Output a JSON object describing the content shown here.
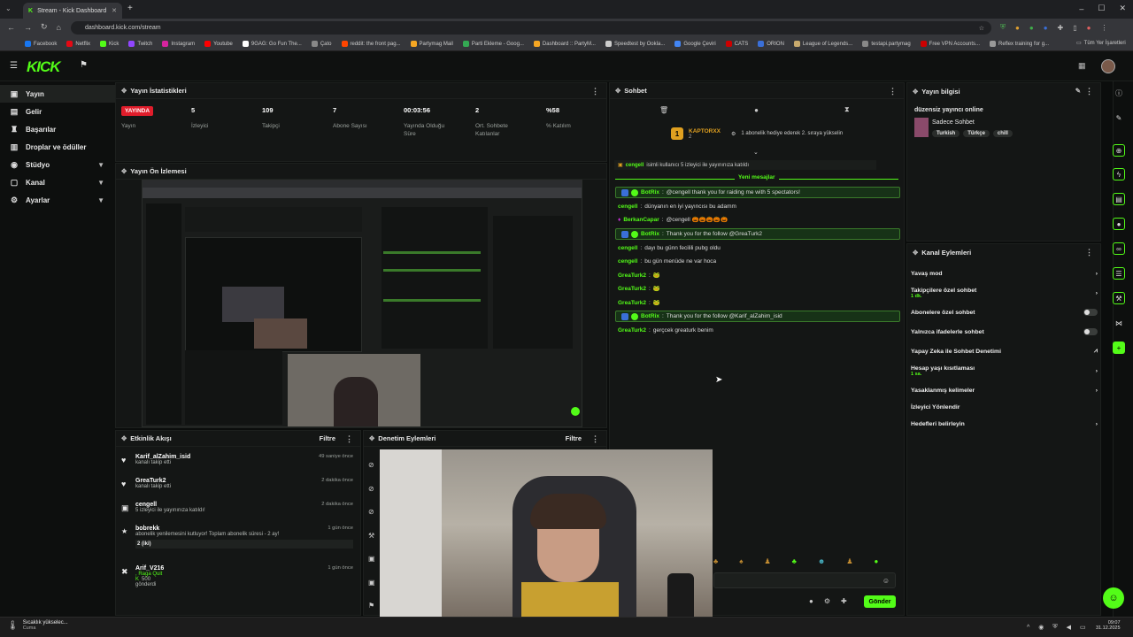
{
  "browser": {
    "tab_title": "Stream - Kick Dashboard",
    "url": "dashboard.kick.com/stream",
    "bookmarks": [
      "Facebook",
      "Netflix",
      "Kick",
      "Twitch",
      "Instagram",
      "Youtube",
      "9GAG: Go Fun The...",
      "Çato",
      "reddit: the front pag...",
      "Partymag Mail",
      "Parti Ekleme - Goog...",
      "Dashboard :: PartyM...",
      "Speedtest by Ookla...",
      "Google Çeviri",
      "CATS",
      "ORION",
      "League of Legends...",
      "testapi.partymag",
      "Free VPN Accounts...",
      "Reflex training for g..."
    ],
    "all_bookmarks": "Tüm Yer İşaretleri"
  },
  "app": {
    "logo": "KICK"
  },
  "sidebar": {
    "items": [
      {
        "label": "Yayın",
        "icon": "broadcast-icon"
      },
      {
        "label": "Gelir",
        "icon": "wallet-icon"
      },
      {
        "label": "Başarılar",
        "icon": "trophy-icon"
      },
      {
        "label": "Droplar ve ödüller",
        "icon": "gift-icon"
      },
      {
        "label": "Stüdyo",
        "icon": "studio-icon"
      },
      {
        "label": "Kanal",
        "icon": "channel-icon"
      },
      {
        "label": "Ayarlar",
        "icon": "gear-icon"
      }
    ]
  },
  "stats": {
    "title": "Yayın İstatistikleri",
    "live_badge": "YAYINDA",
    "items": [
      {
        "value": "",
        "label": "Yayın"
      },
      {
        "value": "5",
        "label": "İzleyici"
      },
      {
        "value": "109",
        "label": "Takipçi"
      },
      {
        "value": "7",
        "label": "Abone Sayısı"
      },
      {
        "value": "00:03:56",
        "label": "Yayında Olduğu Süre"
      },
      {
        "value": "2",
        "label": "Ort. Sohbete Katılanlar"
      },
      {
        "value": "%58",
        "label": "% Katılım"
      }
    ]
  },
  "preview": {
    "title": "Yayın Ön İzlemesi"
  },
  "activity": {
    "title": "Etkinlik Akışı",
    "filter": "Filtre",
    "items": [
      {
        "name": "Karif_alZahim_isid",
        "desc": "kanalı takip etti",
        "time": "49 saniye önce"
      },
      {
        "name": "GreaTurk2",
        "desc": "kanalı takip etti",
        "time": "2 dakika önce"
      },
      {
        "name": "cengell",
        "desc": "5 izleyici ile yayınınıza katıldı!",
        "time": "2 dakika önce"
      },
      {
        "name": "bobrekk",
        "desc": "abonelik yenilemesini kutluyor! Toplam abonelik süresi - 2 ay!",
        "extra": "2 (iki)",
        "time": "1 gün önce"
      },
      {
        "name": "Arif_V216",
        "desc": ", Raga Quit",
        "extra": "500",
        "extra2": "gönderdi",
        "time": "1 gün önce"
      }
    ]
  },
  "moderation": {
    "title": "Denetim Eylemleri",
    "filter": "Filtre"
  },
  "chat": {
    "title": "Sohbet",
    "pinned_user": "KAPTORXX",
    "pinned_level": "2",
    "pinned_text": "1 abonelik hediye ederek 2. sıraya yükselin",
    "raid_notice_user": "cengell",
    "raid_notice_text": "isimli kullanıcı 5 izleyici ile yayınınıza katıldı",
    "new_messages": "Yeni mesajlar",
    "messages": [
      {
        "user": "BotRix",
        "text": "@cengell thank you for raiding me with 5 spectators!",
        "bot": true
      },
      {
        "user": "cengell",
        "text": "dünyanın en iyi yayıncısı bu adamm"
      },
      {
        "user": "BerkanCapar",
        "text": "@cengell 🎃🎃🎃🎃🎃"
      },
      {
        "user": "BotRix",
        "text": "Thank you for the follow @GreaTurk2",
        "bot": true
      },
      {
        "user": "cengell",
        "text": "dayı bu günn fecilili pubg oldu"
      },
      {
        "user": "cengell",
        "text": "bu gün menüde ne var hoca"
      },
      {
        "user": "GreaTurk2",
        "text": "🐸"
      },
      {
        "user": "GreaTurk2",
        "text": "🐸"
      },
      {
        "user": "GreaTurk2",
        "text": "🐸"
      },
      {
        "user": "BotRix",
        "text": "Thank you for the follow @Karif_alZahim_isid",
        "bot": true
      },
      {
        "user": "GreaTurk2",
        "text": "gerçcek greaturk benim"
      }
    ],
    "send_button": "Gönder"
  },
  "stream_info": {
    "title": "Yayın bilgisi",
    "stream_title": "düzensiz yayıncı online",
    "category": "Sadece Sohbet",
    "tags": [
      "Turkish",
      "Türkçe",
      "chill"
    ]
  },
  "channel_actions": {
    "title": "Kanal Eylemleri",
    "items": [
      {
        "label": "Yavaş mod",
        "control": "chevron"
      },
      {
        "label": "Takipçilere özel sohbet",
        "sub": "1 dk.",
        "control": "chevron"
      },
      {
        "label": "Abonelere özel sohbet",
        "control": "toggle"
      },
      {
        "label": "Yalnızca ifadelerle sohbet",
        "control": "toggle"
      },
      {
        "label": "Yapay Zeka ile Sohbet Denetimi",
        "control": "chart"
      },
      {
        "label": "Hesap yaşı kısıtlaması",
        "sub": "1 sa.",
        "control": "chevron"
      },
      {
        "label": "Yasaklanmış kelimeler",
        "control": "chevron"
      },
      {
        "label": "İzleyici Yönlendir",
        "control": "none"
      },
      {
        "label": "Hedefleri belirleyin",
        "control": "chevron"
      }
    ]
  },
  "taskbar": {
    "weather": "Sıcaklık yükselec...",
    "weather_sub": "Cuma",
    "time": "09:07",
    "date": "31.12.2025"
  },
  "colors": {
    "accent": "#53fc18",
    "live": "#e11d2b",
    "panel": "#141615"
  }
}
